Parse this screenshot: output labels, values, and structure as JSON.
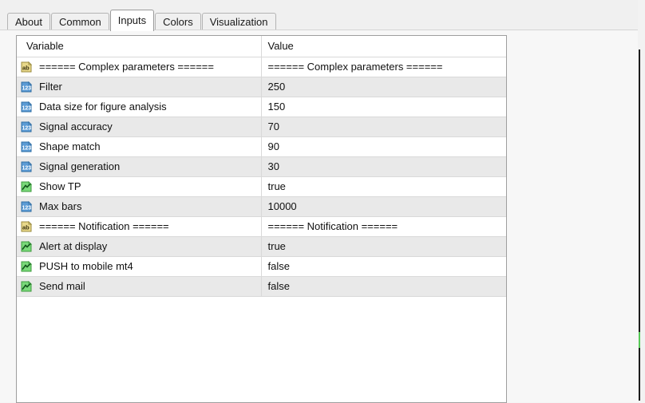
{
  "tabs": [
    {
      "label": "About",
      "selected": false
    },
    {
      "label": "Common",
      "selected": false
    },
    {
      "label": "Inputs",
      "selected": true
    },
    {
      "label": "Colors",
      "selected": false
    },
    {
      "label": "Visualization",
      "selected": false
    }
  ],
  "table": {
    "headers": {
      "variable": "Variable",
      "value": "Value"
    },
    "rows": [
      {
        "icon": "string-type-icon",
        "variable": "====== Complex parameters ======",
        "value": "====== Complex parameters ======"
      },
      {
        "icon": "number-type-icon",
        "variable": "Filter",
        "value": "250"
      },
      {
        "icon": "number-type-icon",
        "variable": "Data size for figure analysis",
        "value": "150"
      },
      {
        "icon": "number-type-icon",
        "variable": "Signal accuracy",
        "value": "70"
      },
      {
        "icon": "number-type-icon",
        "variable": "Shape match",
        "value": "90"
      },
      {
        "icon": "number-type-icon",
        "variable": "Signal generation",
        "value": "30"
      },
      {
        "icon": "boolean-type-icon",
        "variable": "Show TP",
        "value": "true"
      },
      {
        "icon": "number-type-icon",
        "variable": "Max bars",
        "value": "10000"
      },
      {
        "icon": "string-type-icon",
        "variable": "====== Notification ======",
        "value": "====== Notification ======"
      },
      {
        "icon": "boolean-type-icon",
        "variable": "Alert at display",
        "value": "true"
      },
      {
        "icon": "boolean-type-icon",
        "variable": "PUSH to mobile mt4",
        "value": "false"
      },
      {
        "icon": "boolean-type-icon",
        "variable": "Send mail",
        "value": "false"
      }
    ]
  },
  "colors": {
    "string_icon": "#e8d88a",
    "number_icon": "#5b9bd5",
    "boolean_icon": "#7ad97a",
    "row_stripe": "#e9e9e9",
    "selected_tab": "#ffffff",
    "accent_edge": "#57c957"
  }
}
